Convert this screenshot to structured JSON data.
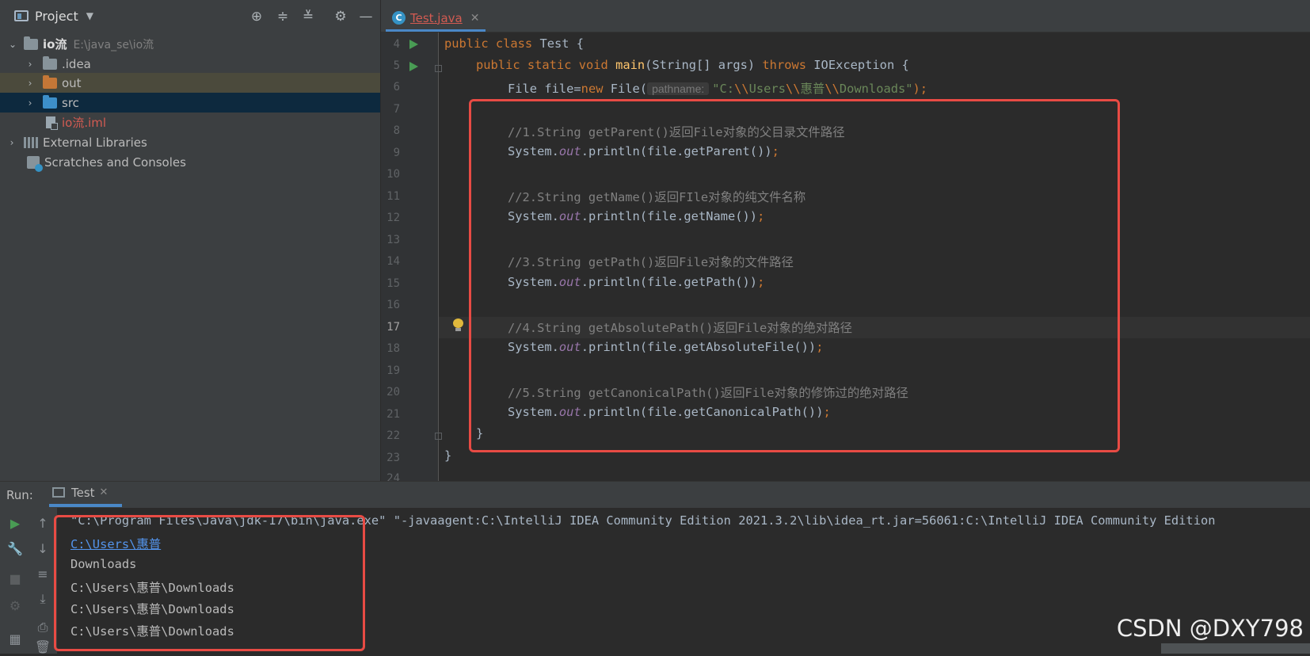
{
  "project": {
    "title": "Project",
    "tree": [
      {
        "name": "io流",
        "path": "E:\\java_se\\io流"
      },
      {
        "name": ".idea"
      },
      {
        "name": "out"
      },
      {
        "name": "src"
      },
      {
        "name": "io流.iml"
      },
      {
        "name": "External Libraries"
      },
      {
        "name": "Scratches and Consoles"
      }
    ]
  },
  "editor": {
    "tab": "Test.java",
    "tab_icon": "C",
    "lines": [
      {
        "num": "4"
      },
      {
        "num": "5"
      },
      {
        "num": "6"
      },
      {
        "num": "7"
      },
      {
        "num": "8"
      },
      {
        "num": "9"
      },
      {
        "num": "10"
      },
      {
        "num": "11"
      },
      {
        "num": "12"
      },
      {
        "num": "13"
      },
      {
        "num": "14"
      },
      {
        "num": "15"
      },
      {
        "num": "16"
      },
      {
        "num": "17"
      },
      {
        "num": "18"
      },
      {
        "num": "19"
      },
      {
        "num": "20"
      },
      {
        "num": "21"
      },
      {
        "num": "22"
      },
      {
        "num": "23"
      },
      {
        "num": "24"
      }
    ],
    "code": {
      "l4_kw": "public class ",
      "l4_name": "Test {",
      "l5_kw": "public static void ",
      "l5_fn": "main",
      "l5_mid": "(String[] args) ",
      "l5_kw2": "throws ",
      "l5_end": "IOException {",
      "l6_a": "File file=",
      "l6_kw": "new ",
      "l6_b": "File(",
      "l6_hint": "pathname:",
      "l6_str": "\"C:",
      "l6_esc1": "\\\\",
      "l6_str2": "Users",
      "l6_esc2": "\\\\",
      "l6_str3": "惠普",
      "l6_esc3": "\\\\",
      "l6_str4": "Downloads\"",
      "l6_end": ");",
      "l8": "//1.String getParent()返回File对象的父目录文件路径",
      "l9_a": "System.",
      "l9_f": "out",
      "l9_b": ".println(file.getParent())",
      "l9_semi": ";",
      "l11": "//2.String getName()返回FIle对象的纯文件名称",
      "l12_a": "System.",
      "l12_f": "out",
      "l12_b": ".println(file.getName())",
      "l12_semi": ";",
      "l14": "//3.String getPath()返回File对象的文件路径",
      "l15_a": "System.",
      "l15_f": "out",
      "l15_b": ".println(file.getPath())",
      "l15_semi": ";",
      "l17": "//4.String getAbsolutePath()返回File对象的绝对路径",
      "l18_a": "System.",
      "l18_f": "out",
      "l18_b": ".println(file.getAbsoluteFile())",
      "l18_semi": ";",
      "l20": "//5.String getCanonicalPath()返回File对象的修饰过的绝对路径",
      "l21_a": "System.",
      "l21_f": "out",
      "l21_b": ".println(file.getCanonicalPath())",
      "l21_semi": ";",
      "l22": "}",
      "l23": "}"
    }
  },
  "run": {
    "label": "Run:",
    "tab": "Test",
    "console": [
      "\"C:\\Program Files\\Java\\jdk-17\\bin\\java.exe\" \"-javaagent:C:\\IntelliJ IDEA Community Edition 2021.3.2\\lib\\idea_rt.jar=56061:C:\\IntelliJ IDEA Community Edition",
      "C:\\Users\\惠普",
      "Downloads",
      "C:\\Users\\惠普\\Downloads",
      "C:\\Users\\惠普\\Downloads",
      "C:\\Users\\惠普\\Downloads"
    ]
  },
  "watermark": "CSDN @DXY798",
  "colors": {
    "highlight": "#e84b44",
    "accent": "#4a88c7",
    "run_green": "#499c54"
  },
  "icons": {
    "header": [
      "locate-icon",
      "expand-all-icon",
      "collapse-all-icon",
      "gear-icon",
      "minimize-icon"
    ]
  }
}
